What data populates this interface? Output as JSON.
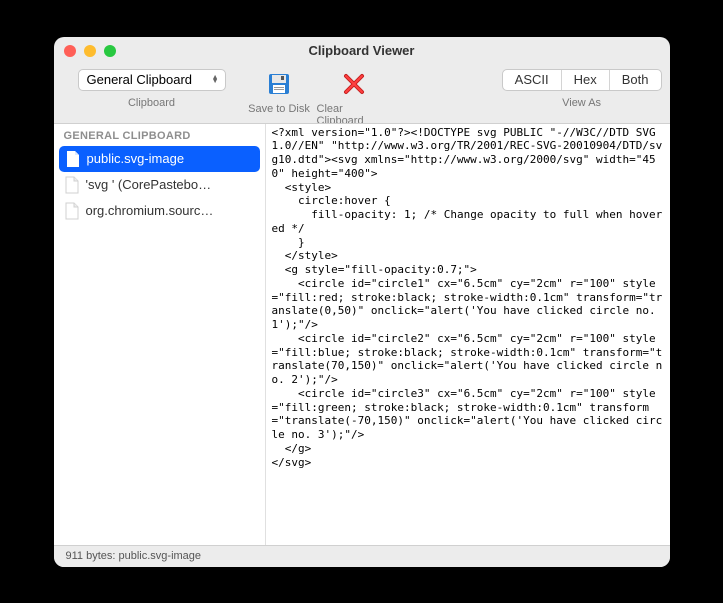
{
  "window": {
    "title": "Clipboard Viewer"
  },
  "toolbar": {
    "clipboard_select": "General Clipboard",
    "clipboard_label": "Clipboard",
    "save_label": "Save to Disk",
    "clear_label": "Clear Clipboard",
    "viewas_label": "View As",
    "seg_ascii": "ASCII",
    "seg_hex": "Hex",
    "seg_both": "Both"
  },
  "sidebar": {
    "header": "GENERAL CLIPBOARD",
    "items": [
      {
        "label": "public.svg-image",
        "selected": true
      },
      {
        "label": "'svg ' (CorePastebo…",
        "selected": false
      },
      {
        "label": "org.chromium.sourc…",
        "selected": false
      }
    ]
  },
  "content": {
    "text": "<?xml version=\"1.0\"?><!DOCTYPE svg PUBLIC \"-//W3C//DTD SVG 1.0//EN\" \"http://www.w3.org/TR/2001/REC-SVG-20010904/DTD/svg10.dtd\"><svg xmlns=\"http://www.w3.org/2000/svg\" width=\"450\" height=\"400\">\n  <style>\n    circle:hover {\n      fill-opacity: 1; /* Change opacity to full when hovered */\n    }\n  </style>\n  <g style=\"fill-opacity:0.7;\">\n    <circle id=\"circle1\" cx=\"6.5cm\" cy=\"2cm\" r=\"100\" style=\"fill:red; stroke:black; stroke-width:0.1cm\" transform=\"translate(0,50)\" onclick=\"alert('You have clicked circle no. 1');\"/>\n    <circle id=\"circle2\" cx=\"6.5cm\" cy=\"2cm\" r=\"100\" style=\"fill:blue; stroke:black; stroke-width:0.1cm\" transform=\"translate(70,150)\" onclick=\"alert('You have clicked circle no. 2');\"/>\n    <circle id=\"circle3\" cx=\"6.5cm\" cy=\"2cm\" r=\"100\" style=\"fill:green; stroke:black; stroke-width:0.1cm\" transform=\"translate(-70,150)\" onclick=\"alert('You have clicked circle no. 3');\"/>\n  </g>\n</svg>"
  },
  "statusbar": {
    "text": "911 bytes: public.svg-image"
  }
}
